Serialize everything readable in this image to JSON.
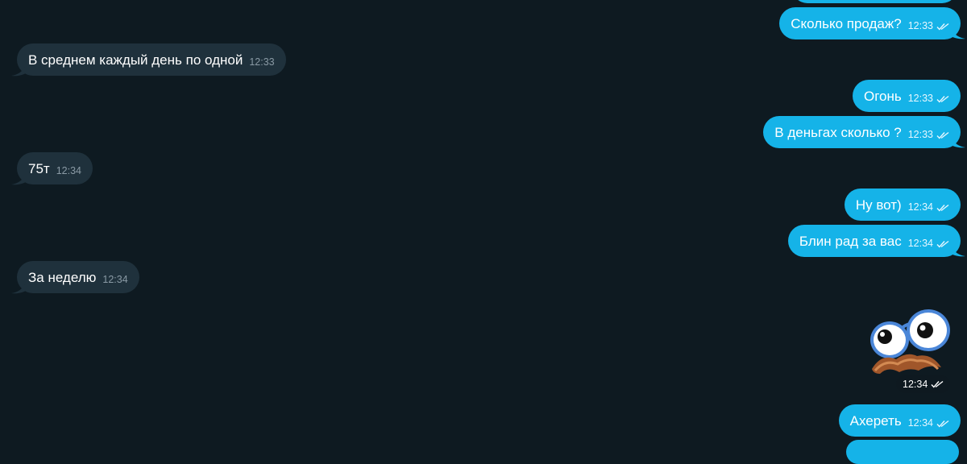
{
  "messages": [
    {
      "id": "m0",
      "dir": "out",
      "text": "",
      "time": ""
    },
    {
      "id": "m1",
      "dir": "out",
      "text": "Сколько продаж?",
      "time": "12:33",
      "read": true
    },
    {
      "id": "m2",
      "dir": "in",
      "text": "В среднем каждый день по одной",
      "time": "12:33"
    },
    {
      "id": "m3",
      "dir": "out",
      "text": "Огонь",
      "time": "12:33",
      "read": true
    },
    {
      "id": "m4",
      "dir": "out",
      "text": "В деньгах сколько ?",
      "time": "12:33",
      "read": true
    },
    {
      "id": "m5",
      "dir": "in",
      "text": "75т",
      "time": "12:34"
    },
    {
      "id": "m6",
      "dir": "out",
      "text": "Ну вот)",
      "time": "12:34",
      "read": true
    },
    {
      "id": "m7",
      "dir": "out",
      "text": "Блин рад за вас",
      "time": "12:34",
      "read": true
    },
    {
      "id": "m8",
      "dir": "in",
      "text": "За неделю",
      "time": "12:34"
    },
    {
      "id": "m9",
      "dir": "out",
      "type": "sticker",
      "sticker": "googly-eyes-mustache-icon",
      "time": "12:34",
      "read": true
    },
    {
      "id": "m10",
      "dir": "out",
      "text": "Ахереть",
      "time": "12:34",
      "read": true
    }
  ],
  "colors": {
    "background": "#0e1a21",
    "incoming_bubble": "#1f313c",
    "outgoing_bubble": "#15b3e8"
  }
}
